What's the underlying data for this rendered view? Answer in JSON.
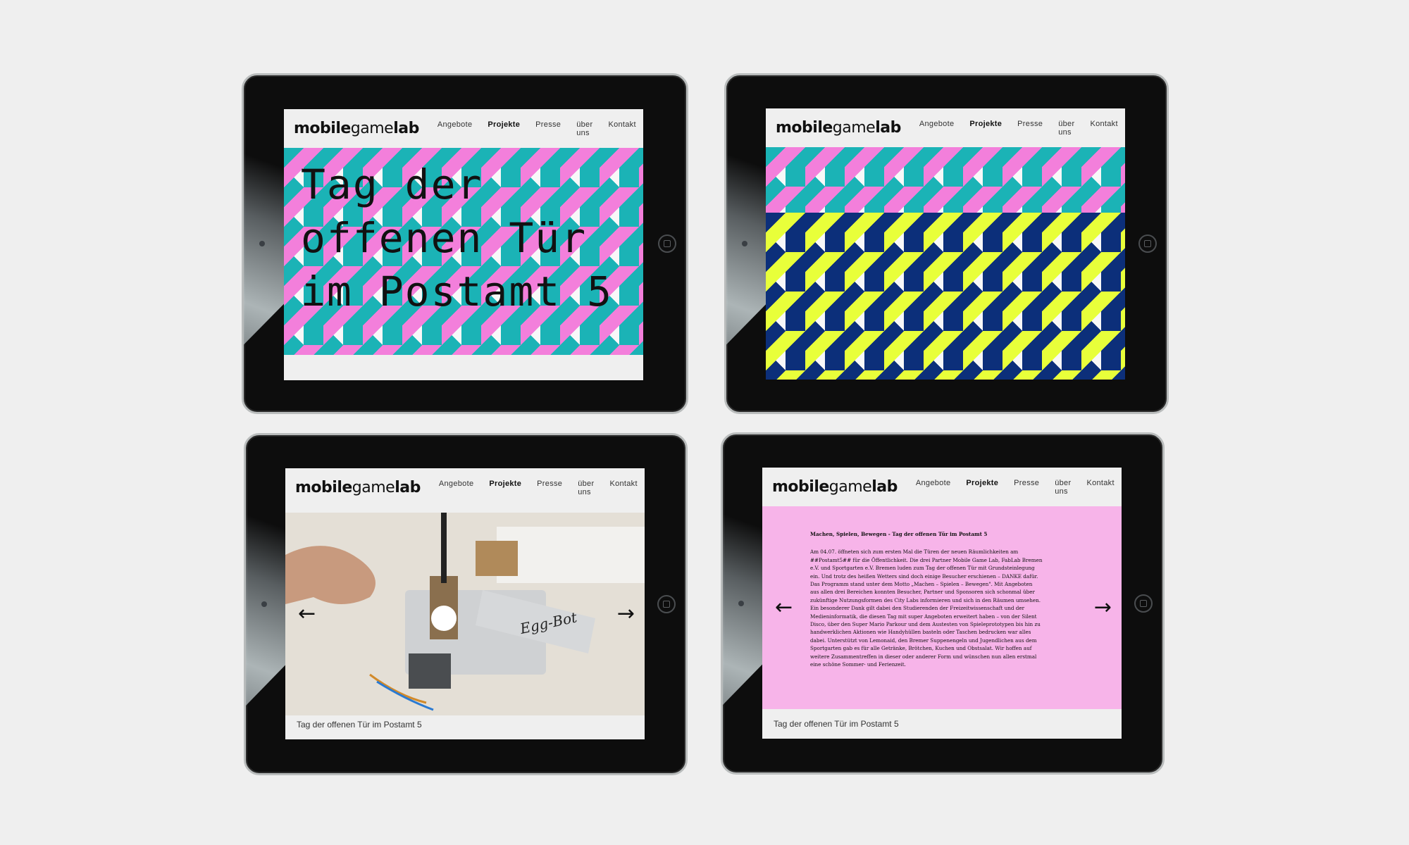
{
  "header": {
    "logo_bold": "mobile",
    "logo_light": "game",
    "logo_bold2": "lab",
    "nav": [
      "Angebote",
      "Projekte",
      "Presse",
      "über uns",
      "Kontakt"
    ],
    "active_nav": "Projekte"
  },
  "screen1": {
    "title_line1": "Tag der",
    "title_line2": "offenen Tür",
    "title_line3": "im Postamt 5"
  },
  "screen3": {
    "caption": "Tag der offenen Tür im Postamt 5",
    "photo_label": "Egg-Bot"
  },
  "screen4": {
    "headline": "Machen, Spielen, Bewegen - Tag der offenen Tür im Postamt 5",
    "body": "Am 04.07. öffneten sich zum ersten Mal die Türen der neuen Räumlichkeiten am ##Postamt5## für die Öffentlichkeit. Die drei Partner Mobile Game Lab, FabLab Bremen e.V. und Sportgarten e.V. Bremen luden zum Tag der offenen Tür mit Grundsteinlegung ein. Und trotz des heißen Wetters sind doch einige Besucher erschienen – DANKE dafür. Das Programm stand unter dem Motto „Machen – Spielen – Bewegen\". Mit Angeboten aus allen drei Bereichen konnten Besucher, Partner und Sponsoren sich schonmal über zukünftige Nutzungsformen des City Labs informieren und sich in den Räumen umsehen. Ein besonderer Dank gilt dabei den Studierenden der Freizeitwissenschaft und der Medieninformatik, die diesen Tag mit super Angeboten erweitert haben – von der Silent Disco, über den Super Mario Parkour und dem Austesten von Spieleprototypen bis hin zu handwerklichen Aktionen wie Handyhüllen basteln oder Taschen bedrucken war alles dabei. Unterstützt von Lemonaid, den Bremer Suppenengeln und Jugendlichen aus dem Sportgarten gab es für alle Getränke, Brötchen, Kuchen und Obstsalat. Wir hoffen auf weitere Zusammentreffen in dieser oder anderer Form und wünschen nun allen erstmal eine schöne Sommer- und Ferienzeit.",
    "caption": "Tag der offenen Tür im Postamt 5"
  },
  "arrows": {
    "left": "←",
    "right": "→"
  },
  "colors": {
    "pink": "#f37fdb",
    "teal": "#1bb3b6",
    "yellow": "#e8ff3a",
    "navy": "#0c2f7a",
    "panel_pink": "#f7b4e9"
  }
}
